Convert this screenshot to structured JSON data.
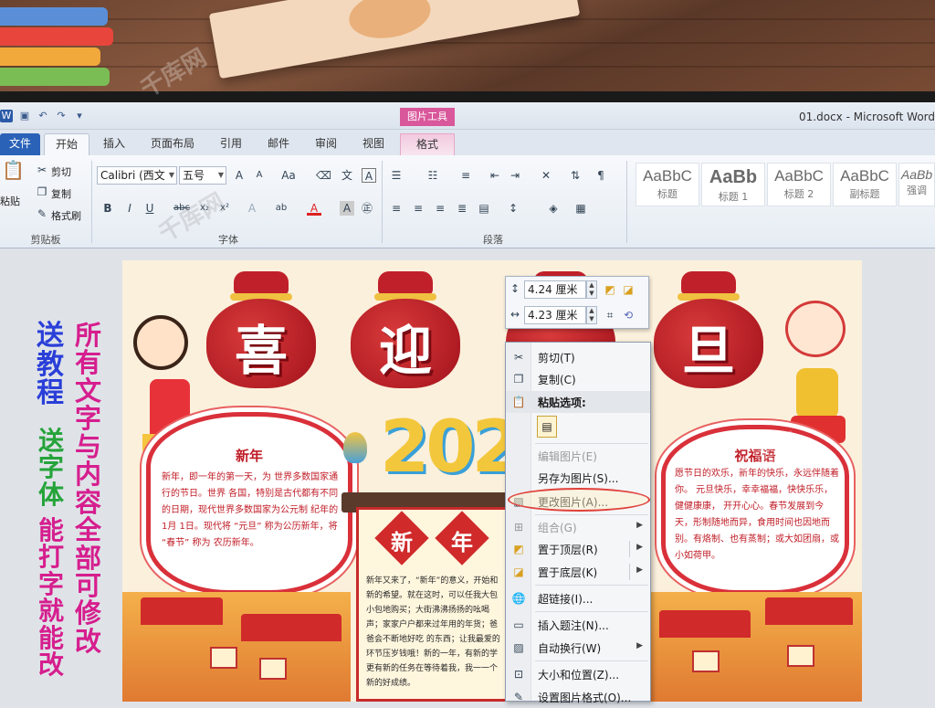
{
  "window": {
    "title": "01.docx - Microsoft Word"
  },
  "context_tab_header": "图片工具",
  "tabs": [
    {
      "label": "文件"
    },
    {
      "label": "开始"
    },
    {
      "label": "插入"
    },
    {
      "label": "页面布局"
    },
    {
      "label": "引用"
    },
    {
      "label": "邮件"
    },
    {
      "label": "审阅"
    },
    {
      "label": "视图"
    },
    {
      "label": "格式"
    }
  ],
  "clipboard": {
    "paste": "粘贴",
    "cut": "剪切",
    "copy": "复制",
    "format_painter": "格式刷",
    "group": "剪贴板"
  },
  "font": {
    "name": "Calibri (西文",
    "size": "五号",
    "group": "字体"
  },
  "paragraph": {
    "group": "段落"
  },
  "styles": [
    {
      "sample": "AaBbC",
      "name": "标题"
    },
    {
      "sample": "AaBb",
      "name": "标题 1"
    },
    {
      "sample": "AaBbC",
      "name": "标题 2"
    },
    {
      "sample": "AaBbC",
      "name": "副标题"
    },
    {
      "sample": "AaBb",
      "name": "强调"
    }
  ],
  "side_text": {
    "left_col1": [
      "送",
      "教",
      "程"
    ],
    "left_col2": [
      "送",
      "字",
      "体"
    ],
    "left_col3": [
      "能",
      "打",
      "字",
      "就",
      "能",
      "改"
    ],
    "right_col": [
      "所",
      "有",
      "文",
      "字",
      "与",
      "内",
      "容",
      "全",
      "部",
      "可",
      "修",
      "改"
    ]
  },
  "poster": {
    "bags": [
      "喜",
      "迎",
      "旦"
    ],
    "year": "202",
    "left_card": {
      "title": "新年",
      "body": "新年，即一年的第一天，为 世界多数国家通行的节日。世界 各国，特别是古代都有不同的日期，现代世界多数国家为公元制 纪年的 1月 1日。现代将 “元旦” 称为公历新年，将 “春节” 称为 农历新年。"
    },
    "right_card": {
      "title": "祝福语",
      "body": "愿节日的欢乐，新年的快乐，永远伴随着你。 元旦快乐，幸幸福福，快快乐乐，健健康康， 开开心心。春节发展到今天，形制随地而异，食用时间也因地而别。有烙制、也有蒸制；或大如团扇，或小如荷甲。"
    },
    "center_title": [
      "新",
      "年"
    ],
    "center_text": "新年又来了，“新年”的意义，开始和新的希望。就在这时，可以任我大包小包地购买；大街沸沸扬扬的吆喝声；家家户户都来过年用的年货；爸爸会不断地好吃 的东西；让我最爱的环节压岁钱哦！新的一年，有新的学更有新的任务在等待着我，我一一个新的好成绩。"
  },
  "size_toolbar": {
    "height": "4.24 厘米",
    "width": "4.23 厘米"
  },
  "context_menu": [
    {
      "label": "剪切(T)",
      "icon": "scissors-icon",
      "enabled": true
    },
    {
      "label": "复制(C)",
      "icon": "copy-icon",
      "enabled": true
    },
    {
      "label": "粘贴选项:",
      "icon": "paste-icon",
      "enabled": true,
      "section": true
    },
    {
      "label": "编辑图片(E)",
      "icon": "",
      "enabled": false
    },
    {
      "label": "另存为图片(S)...",
      "icon": "",
      "enabled": true
    },
    {
      "label": "更改图片(A)...",
      "icon": "change-picture-icon",
      "enabled": true,
      "highlighted": true
    },
    {
      "label": "组合(G)",
      "icon": "group-icon",
      "enabled": false,
      "submenu": true
    },
    {
      "label": "置于顶层(R)",
      "icon": "bring-front-icon",
      "enabled": true,
      "submenu": true
    },
    {
      "label": "置于底层(K)",
      "icon": "send-back-icon",
      "enabled": true,
      "submenu": true
    },
    {
      "label": "超链接(I)...",
      "icon": "hyperlink-icon",
      "enabled": true
    },
    {
      "label": "插入题注(N)...",
      "icon": "caption-icon",
      "enabled": true
    },
    {
      "label": "自动换行(W)",
      "icon": "wrap-icon",
      "enabled": true,
      "submenu": true
    },
    {
      "label": "大小和位置(Z)...",
      "icon": "size-position-icon",
      "enabled": true
    },
    {
      "label": "设置图片格式(O)...",
      "icon": "format-picture-icon",
      "enabled": true
    }
  ],
  "colors": {
    "ribbon_file_tab": "#2a62b8",
    "context_tab": "#d9579b",
    "poster_red": "#c01c26",
    "menu_highlight_ring": "#e0403a"
  }
}
